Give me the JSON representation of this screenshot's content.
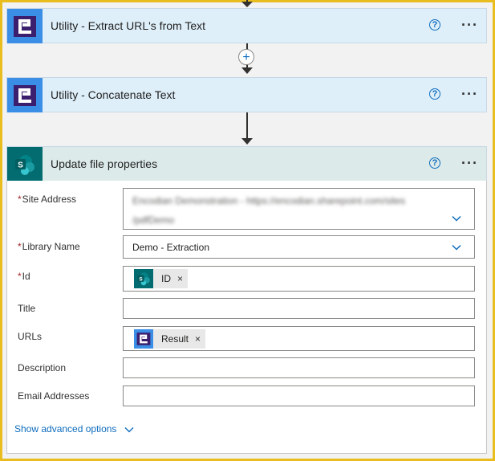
{
  "cards": {
    "extract": {
      "title": "Utility - Extract URL's from Text",
      "help": "?",
      "more": "···"
    },
    "concat": {
      "title": "Utility - Concatenate Text",
      "help": "?",
      "more": "···"
    },
    "update": {
      "title": "Update file properties",
      "help": "?",
      "more": "···"
    }
  },
  "connector": {
    "add_label": "+"
  },
  "form": {
    "site_address": {
      "label": "Site Address",
      "required": "*",
      "value_line1": "Encodian Demonstration - https://encodian.sharepoint.com/sites",
      "value_line2": "/pdfDemo"
    },
    "library_name": {
      "label": "Library Name",
      "required": "*",
      "value": "Demo - Extraction"
    },
    "id": {
      "label": "Id",
      "required": "*",
      "token": "ID",
      "remove": "×"
    },
    "title": {
      "label": "Title",
      "value": ""
    },
    "urls": {
      "label": "URLs",
      "token": "Result",
      "remove": "×"
    },
    "description": {
      "label": "Description",
      "value": ""
    },
    "email": {
      "label": "Email Addresses",
      "value": ""
    },
    "advanced": "Show advanced options"
  },
  "icons": {
    "utility": "encodian-utility-icon",
    "sharepoint": "sharepoint-icon",
    "help": "help-circle-icon",
    "more": "more-ellipsis-icon",
    "chevron": "chevron-down-icon"
  },
  "colors": {
    "border": "#e8bd1d",
    "accent": "#0f6cbd",
    "utility_tile": "#3a8ee6",
    "sharepoint_tile": "#036c70"
  }
}
